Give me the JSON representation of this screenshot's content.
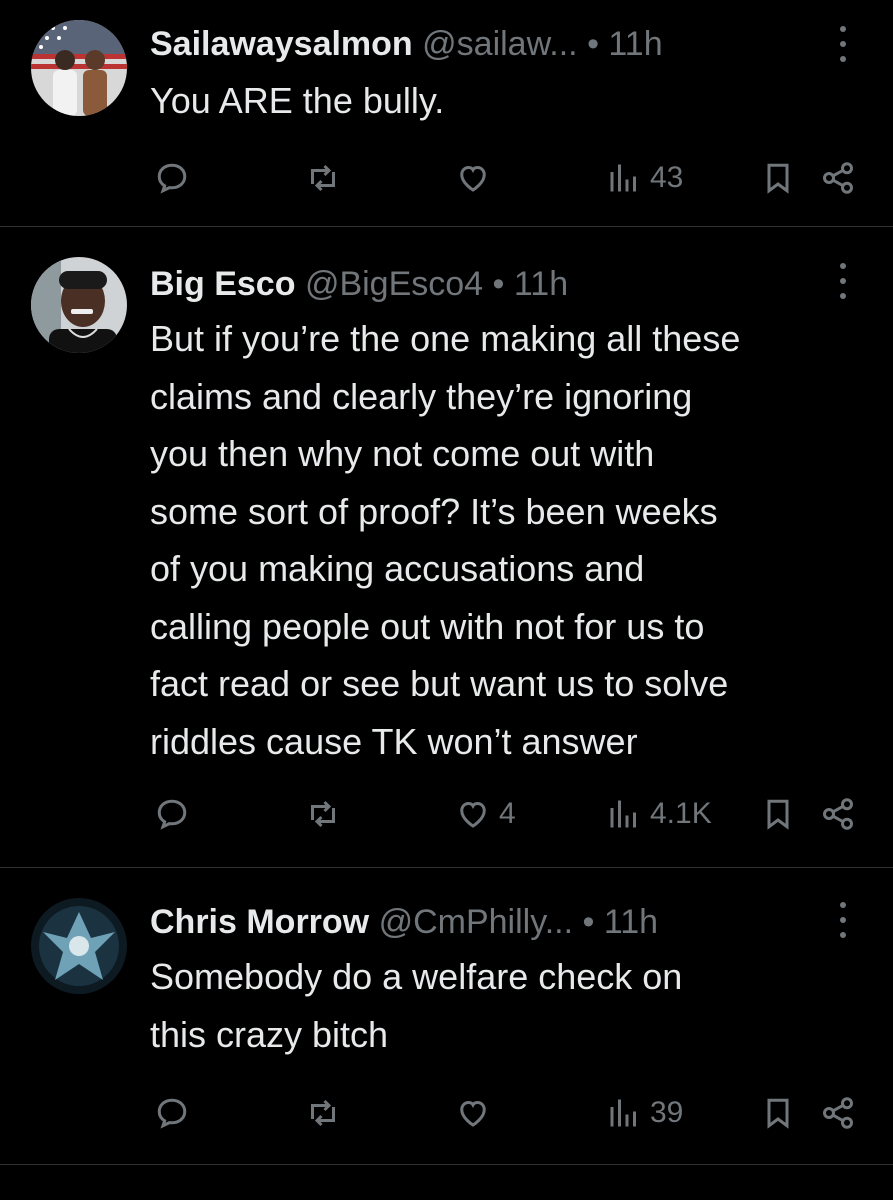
{
  "tweets": [
    {
      "name": "Sailawaysalmon",
      "handle": "@sailaw...",
      "dot": "•",
      "time": "11h",
      "lines": [
        "You ARE the bully."
      ],
      "replies": "",
      "reposts": "",
      "likes": "",
      "views": "43"
    },
    {
      "name": "Big Esco",
      "handle": "@BigEsco4",
      "dot": "•",
      "time": "11h",
      "lines": [
        "But if you’re the one making all these",
        "claims and clearly they’re ignoring",
        "you then why not come out with",
        "some sort of proof? It’s been weeks",
        "of you making accusations and",
        "calling people out with not for us to",
        "fact read or see but want us to solve",
        "riddles cause TK won’t answer"
      ],
      "replies": "",
      "reposts": "",
      "likes": "4",
      "views": "4.1K"
    },
    {
      "name": "Chris Morrow",
      "handle": "@CmPhilly...",
      "dot": "•",
      "time": "11h",
      "lines": [
        "Somebody do a welfare check on",
        "this crazy bitch"
      ],
      "replies": "",
      "reposts": "",
      "likes": "",
      "views": "39"
    }
  ],
  "icons": {
    "reply": "reply-icon",
    "repost": "repost-icon",
    "like": "like-icon",
    "views": "views-icon",
    "bookmark": "bookmark-icon",
    "share": "share-icon",
    "more": "more-options-icon"
  },
  "colors": {
    "background": "#000000",
    "text": "#e7e9ea",
    "secondary": "#71767b",
    "divider": "#2f3336"
  }
}
